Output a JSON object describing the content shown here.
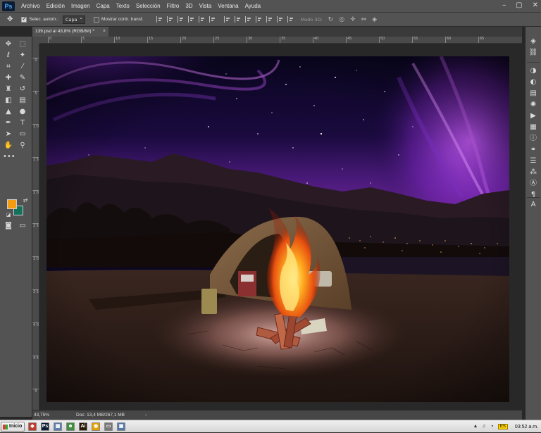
{
  "app": {
    "logo": "Ps",
    "menu": [
      "Archivo",
      "Edición",
      "Imagen",
      "Capa",
      "Texto",
      "Selección",
      "Filtro",
      "3D",
      "Vista",
      "Ventana",
      "Ayuda"
    ],
    "window_controls": [
      "–",
      "▢",
      "✕"
    ]
  },
  "options": {
    "auto_select_label": "Selec. autom.:",
    "auto_select_checked": true,
    "auto_select_target": "Capa",
    "show_transform_label": "Mostrar contr. transf.",
    "show_transform_checked": false,
    "mode3d_label": "Modo 3D:"
  },
  "document": {
    "tab_title": "139.psd al 43,8% (RGB/8#) *",
    "close_glyph": "×"
  },
  "rulers": {
    "h_ticks": [
      "0",
      "5",
      "10",
      "15",
      "20",
      "25",
      "30",
      "35",
      "40",
      "45",
      "50",
      "55",
      "60",
      "65"
    ],
    "v_ticks": [
      "0",
      "5",
      "1 0",
      "1 5",
      "2 0",
      "2 5",
      "3 0",
      "3 5",
      "4 0",
      "4 5",
      "5"
    ]
  },
  "status": {
    "zoom": "43,75%",
    "doc_info": "Doc: 13,4 MB/267,1 MB",
    "arrow": "›"
  },
  "colors": {
    "foreground": "#f39c12",
    "background": "#14705a",
    "ui_panel": "#535353",
    "ui_dark": "#282828"
  },
  "toolbox": {
    "grip_label": "•••"
  },
  "taskbar": {
    "start_label": "Inicio",
    "apps": [
      {
        "glyph": "◆",
        "color": "#c0392b"
      },
      {
        "glyph": "Ps",
        "color": "#0b1c33"
      },
      {
        "glyph": "▦",
        "color": "#5a7fb0"
      },
      {
        "glyph": "☻",
        "color": "#3f8f3f"
      },
      {
        "glyph": "Ai",
        "color": "#2b1a06"
      },
      {
        "glyph": "◉",
        "color": "#e5a100"
      },
      {
        "glyph": "▭",
        "color": "#777"
      },
      {
        "glyph": "▣",
        "color": "#5577aa"
      }
    ],
    "tray_icons": [
      "▲",
      "♫",
      "▪"
    ],
    "tray_badge": "ES",
    "clock": "03:52 a.m."
  }
}
